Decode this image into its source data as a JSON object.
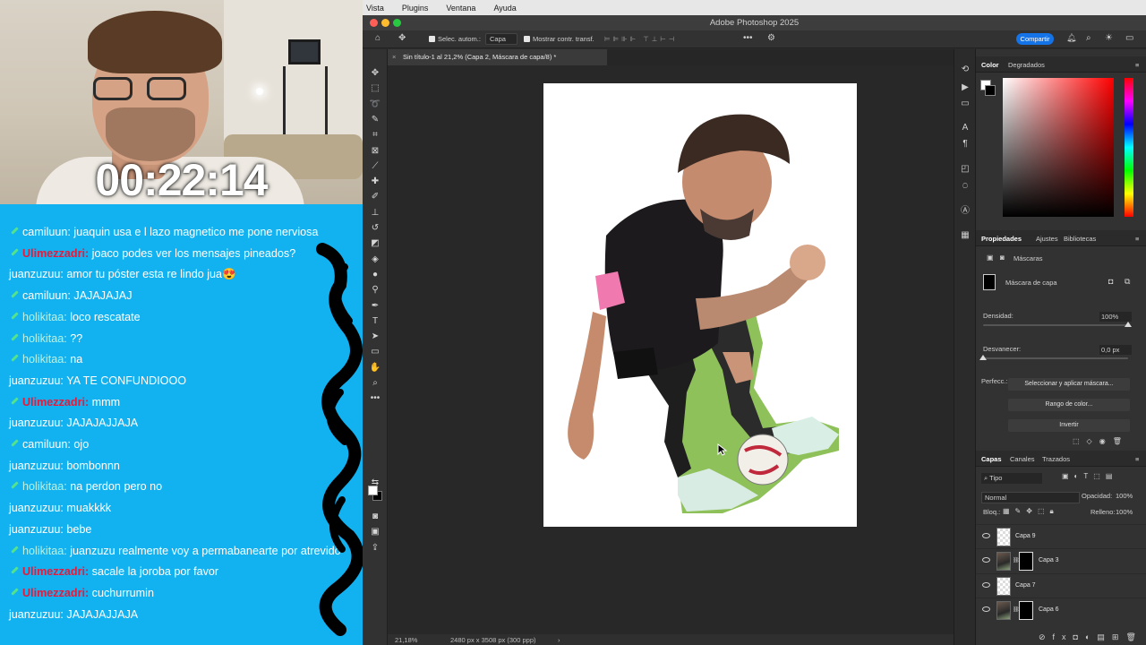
{
  "stream": {
    "timer": "00:22:14",
    "chat": [
      {
        "badge": true,
        "user": "camiluun:",
        "user_style": "white",
        "text": " juaquin usa e l lazo magnetico me pone nerviosa"
      },
      {
        "badge": true,
        "user": "Ulimezzadri:",
        "user_style": "red",
        "text": " joaco podes ver los mensajes pineados?"
      },
      {
        "badge": false,
        "user": "juanzuzuu:",
        "user_style": "white",
        "text": " amor tu póster esta re lindo jua😍"
      },
      {
        "badge": true,
        "user": "camiluun:",
        "user_style": "white",
        "text": " JAJAJAJAJ"
      },
      {
        "badge": true,
        "user": "holikitaa:",
        "user_style": "teal",
        "text": " loco rescatate"
      },
      {
        "badge": true,
        "user": "holikitaa:",
        "user_style": "teal",
        "text": " ??"
      },
      {
        "badge": true,
        "user": "holikitaa:",
        "user_style": "teal",
        "text": " na"
      },
      {
        "badge": false,
        "user": "juanzuzuu:",
        "user_style": "white",
        "text": " YA TE CONFUNDIOOO"
      },
      {
        "badge": true,
        "user": "Ulimezzadri:",
        "user_style": "red",
        "text": " mmm"
      },
      {
        "badge": false,
        "user": "juanzuzuu:",
        "user_style": "white",
        "text": " JAJAJAJJAJA"
      },
      {
        "badge": true,
        "user": "camiluun:",
        "user_style": "white",
        "text": " ojo"
      },
      {
        "badge": false,
        "user": "juanzuzuu:",
        "user_style": "white",
        "text": " bombonnn"
      },
      {
        "badge": true,
        "user": "holikitaa:",
        "user_style": "teal",
        "text": " na perdon pero no"
      },
      {
        "badge": false,
        "user": "juanzuzuu:",
        "user_style": "white",
        "text": " muakkkk"
      },
      {
        "badge": false,
        "user": "juanzuzuu:",
        "user_style": "white",
        "text": " bebe"
      },
      {
        "badge": true,
        "user": "holikitaa:",
        "user_style": "teal",
        "text": " juanzuzu realmente voy a permabanearte por atrevido"
      },
      {
        "badge": true,
        "user": "Ulimezzadri:",
        "user_style": "red",
        "text": " sacale la joroba por favor"
      },
      {
        "badge": true,
        "user": "Ulimezzadri:",
        "user_style": "red",
        "text": " cuchurrumin"
      },
      {
        "badge": false,
        "user": "juanzuzuu:",
        "user_style": "white",
        "text": " JAJAJAJJAJA"
      }
    ]
  },
  "ps": {
    "menu": [
      "Vista",
      "Plugins",
      "Ventana",
      "Ayuda"
    ],
    "window_title": "Adobe Photoshop 2025",
    "options": {
      "auto_select_label": "Selec. autom.:",
      "auto_select_value": "Capa",
      "show_transform_label": "Mostrar contr. transf.",
      "share": "Compartir"
    },
    "doc_tab": "Sin título-1 al 21,2% (Capa 2, Máscara de capa/8) *",
    "status": {
      "zoom": "21,18%",
      "dims": "2480 px x 3508 px (300 ppp)"
    },
    "color_tabs": [
      "Color",
      "Degradados"
    ],
    "props_tabs": [
      "Propiedades",
      "Ajustes",
      "Bibliotecas"
    ],
    "props": {
      "section": "Máscaras",
      "mask_label": "Máscara de capa",
      "density_label": "Densidad:",
      "density_value": "100%",
      "density_level": 1.0,
      "feather_label": "Desvanecer:",
      "feather_value": "0,0 px",
      "feather_level": 0.0,
      "refine_label": "Perfecc.:",
      "btn_select_mask": "Seleccionar y aplicar máscara...",
      "btn_color_range": "Rango de color...",
      "btn_invert": "Invertir"
    },
    "layers_tabs": [
      "Capas",
      "Canales",
      "Trazados"
    ],
    "layers": {
      "filter": "Tipo",
      "blend": "Normal",
      "opacity_label": "Opacidad:",
      "opacity_value": "100%",
      "lock_label": "Bloq.:",
      "fill_label": "Relleno:",
      "fill_value": "100%",
      "items": [
        {
          "name": "Capa 9",
          "thumb": "checker",
          "mask": false
        },
        {
          "name": "Capa 3",
          "thumb": "photo",
          "mask": true
        },
        {
          "name": "Capa 7",
          "thumb": "checker",
          "mask": false
        },
        {
          "name": "Capa 6",
          "thumb": "photo",
          "mask": true
        }
      ]
    },
    "colors": {
      "accent": "#1473e6",
      "chat_bg": "#12b1f0",
      "mask_outline": "#7bb84a"
    }
  }
}
